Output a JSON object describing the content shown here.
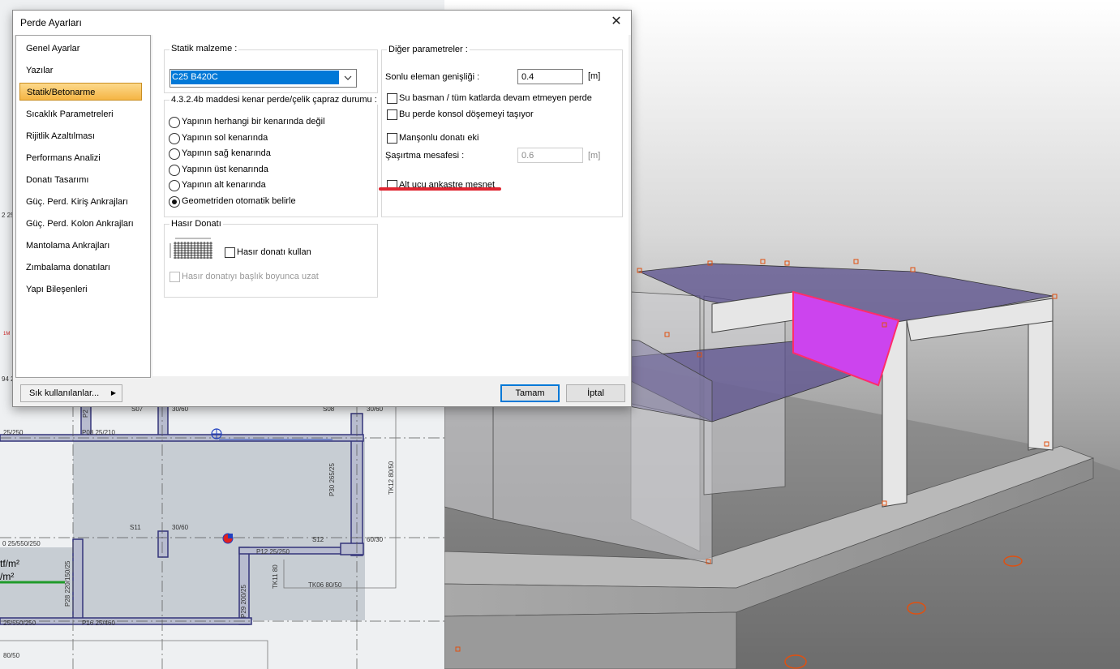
{
  "dialog": {
    "title": "Perde Ayarları",
    "close_symbol": "✕",
    "nav_items": [
      {
        "label": "Genel Ayarlar",
        "selected": false
      },
      {
        "label": "Yazılar",
        "selected": false
      },
      {
        "label": "Statik/Betonarme",
        "selected": true
      },
      {
        "label": "Sıcaklık Parametreleri",
        "selected": false
      },
      {
        "label": "Rijitlik Azaltılması",
        "selected": false
      },
      {
        "label": "Performans Analizi",
        "selected": false
      },
      {
        "label": "Donatı Tasarımı",
        "selected": false
      },
      {
        "label": "Güç. Perd. Kiriş Ankrajları",
        "selected": false
      },
      {
        "label": "Güç. Perd. Kolon Ankrajları",
        "selected": false
      },
      {
        "label": "Mantolama Ankrajları",
        "selected": false
      },
      {
        "label": "Zımbalama donatıları",
        "selected": false
      },
      {
        "label": "Yapı Bileşenleri",
        "selected": false
      }
    ],
    "statik_malzeme": {
      "legend": "Statik malzeme :",
      "value": "C25 B420C"
    },
    "edge": {
      "legend": "4.3.2.4b maddesi kenar perde/çelik çapraz durumu :",
      "options": [
        {
          "label": "Yapının herhangi bir kenarında değil",
          "checked": false
        },
        {
          "label": "Yapının sol kenarında",
          "checked": false
        },
        {
          "label": "Yapının sağ kenarında",
          "checked": false
        },
        {
          "label": "Yapının üst kenarında",
          "checked": false
        },
        {
          "label": "Yapının alt kenarında",
          "checked": false
        },
        {
          "label": "Geometriden otomatik belirle",
          "checked": true
        }
      ]
    },
    "hasir": {
      "legend": "Hasır Donatı",
      "use_label": "Hasır donatı kullan",
      "use_checked": false,
      "extend_label": "Hasır donatıyı başlık boyunca uzat",
      "extend_checked": false
    },
    "other": {
      "legend": "Diğer parametreler :",
      "element_width_label": "Sonlu eleman genişliği :",
      "element_width_value": "0.4",
      "unit": "[m]",
      "basement_label": "Su basman / tüm katlarda devam etmeyen perde",
      "console_label": "Bu perde konsol döşemeyi taşıyor",
      "sleeve_label": "Manşonlu donatı eki",
      "stagger_label": "Şaşırtma mesafesi :",
      "stagger_value": "0.6",
      "fixed_label": "Alt ucu ankastre mesnet"
    },
    "buttons": {
      "favorites": "Sık kullanılanlar...",
      "ok": "Tamam",
      "cancel": "İptal"
    }
  },
  "plan": {
    "labels": [
      "P08 25/210",
      "S07",
      "30/60",
      "S08",
      "30/60",
      "S11",
      "30/60",
      "S12",
      "60/30",
      "P12 25/250",
      "P30 265/25",
      "TK12 80/50",
      "TK11 80",
      "TK06 80/50",
      "P29 200/25",
      "P28 220/150/25",
      "P16 25/460",
      "25/550/250",
      "0 25/550/250",
      "25/250",
      "tf/m²",
      "/m²",
      "80/50",
      "P2"
    ]
  },
  "colors": {
    "selection_blue": "#0078d7",
    "nav_selected": "#f5b544",
    "highlight_red": "#e02430",
    "wall_magenta": "#cc44ee",
    "slab_purple": "#5a4f8c"
  }
}
